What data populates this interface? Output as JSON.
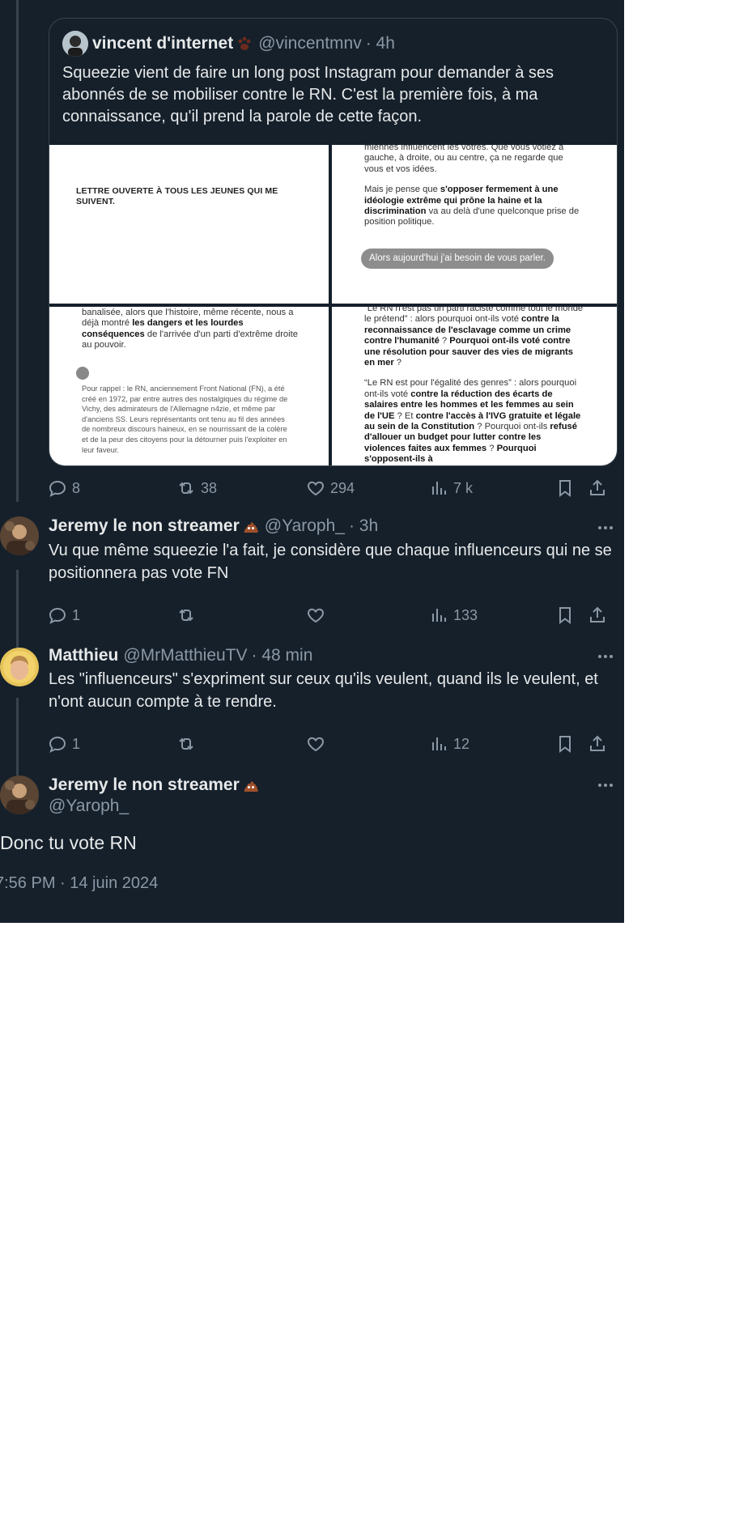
{
  "quoted": {
    "name": "vincent d'internet",
    "handle": "@vincentmnv",
    "time": "· 4h",
    "text": "Squeezie vient de faire un long post Instagram pour demander à ses abonnés de se mobiliser contre le RN. C'est la première fois, à ma connaissance, qu'il prend la parole de cette façon.",
    "images": {
      "img1_title": "LETTRE OUVERTE À TOUS LES JEUNES QUI ME SUIVENT.",
      "img2_p1": "miennes influencent les vôtres. Que vous votiez à gauche, à droite, ou au centre, ça ne regarde que vous et vos idées.",
      "img2_p2_a": "Mais je pense que ",
      "img2_p2_b": "s'opposer fermement à une idéologie extrême qui prône la haine et la discrimination",
      "img2_p2_c": " va au delà d'une quelconque prise de position politique.",
      "img2_bubble": "Alors aujourd'hui j'ai besoin de vous parler.",
      "img3_p1_a": "banalisée, alors que l'histoire, même récente, nous a déjà montré ",
      "img3_p1_b": "les dangers et les lourdes conséquences",
      "img3_p1_c": " de l'arrivée d'un parti d'extrême droite au pouvoir.",
      "img3_p2": "Pour rappel : le RN, anciennement Front National (FN), a été créé en 1972, par entre autres des nostalgiques du régime de Vichy, des admirateurs de l'Allemagne n4zie, et même par d'anciens SS. Leurs représentants ont tenu au fil des années de nombreux discours haineux, en se nourrissant de la colère et de la peur des citoyens pour la détourner puis l'exploiter en leur faveur.",
      "img4_p1_a": "“Le RN n'est pas un parti raciste comme tout le monde le prétend” : alors pourquoi ont-ils voté ",
      "img4_p1_b": "contre la reconnaissance de l'esclavage comme un crime contre l'humanité",
      "img4_p1_c": " ? ",
      "img4_p1_d": "Pourquoi ont-ils voté contre une résolution pour sauver des vies de migrants en mer",
      "img4_p1_e": " ?",
      "img4_p2_a": "“Le RN est pour l'égalité des genres” : alors pourquoi ont-ils voté ",
      "img4_p2_b": "contre la réduction des écarts de salaires entre les hommes et les femmes au sein de l'UE",
      "img4_p2_c": " ? Et ",
      "img4_p2_d": "contre l'accès à l'IVG gratuite et légale au sein de la Constitution",
      "img4_p2_e": " ? Pourquoi ont-ils ",
      "img4_p2_f": "refusé d'allouer un budget pour lutter contre les violences faites aux femmes",
      "img4_p2_g": " ? ",
      "img4_p2_h": "Pourquoi s'opposent-ils à"
    },
    "stats": {
      "replies": "8",
      "reposts": "38",
      "likes": "294",
      "views": "7 k"
    }
  },
  "reply1": {
    "name": "Jeremy le non streamer",
    "handle": "@Yaroph_",
    "time": "· 3h",
    "text": "Vu que même squeezie l'a fait, je considère que chaque influenceurs qui ne se positionnera pas vote FN",
    "stats": {
      "replies": "1",
      "reposts": "",
      "likes": "",
      "views": "133"
    }
  },
  "reply2": {
    "name": "Matthieu",
    "handle": "@MrMatthieuTV",
    "time": "· 48 min",
    "text": "Les \"influenceurs\" s'expriment sur ceux qu'ils veulent, quand ils le veulent, et n'ont aucun compte à te rendre.",
    "stats": {
      "replies": "1",
      "reposts": "",
      "likes": "",
      "views": "12"
    }
  },
  "main": {
    "name": "Jeremy le non streamer",
    "handle": "@Yaroph_",
    "text": "Donc tu vote RN",
    "timestamp": "7:56 PM · 14 juin 2024"
  },
  "colors": {
    "background": "#15202b",
    "text": "#e7e9ea",
    "muted": "#8b98a5",
    "border": "#38444d"
  }
}
